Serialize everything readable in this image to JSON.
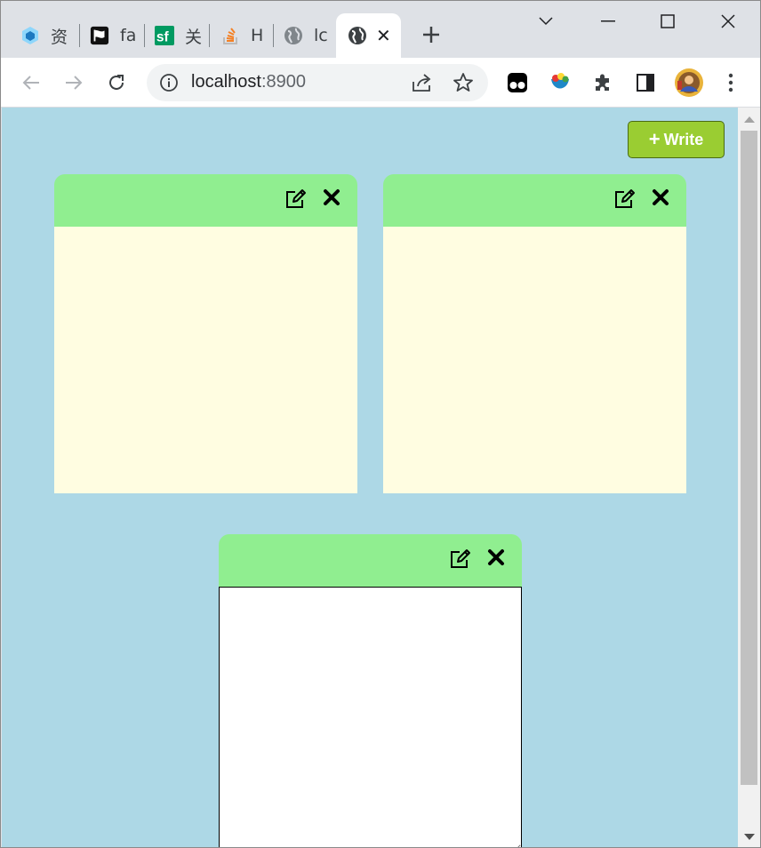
{
  "browser": {
    "tabs": [
      {
        "title": "资",
        "icon": "webpack-cube-icon"
      },
      {
        "title": "fa",
        "icon": "flag-icon"
      },
      {
        "title": "关",
        "icon": "segmentfault-icon"
      },
      {
        "title": "H",
        "icon": "stackoverflow-icon"
      },
      {
        "title": "lc",
        "icon": "globe-icon"
      },
      {
        "title": "",
        "icon": "globe-icon",
        "active": true
      }
    ],
    "url_host": "localhost",
    "url_port": ":8900"
  },
  "toolbar": {
    "write_label": "Write",
    "write_icon": "plus-icon"
  },
  "notes": [
    {
      "mode": "view",
      "text": ""
    },
    {
      "mode": "view",
      "text": ""
    },
    {
      "mode": "edit",
      "text": ""
    }
  ],
  "colors": {
    "page_bg": "#add8e6",
    "note_header": "#90ee90",
    "note_body": "#fffde1",
    "write_button": "#9acd32"
  }
}
